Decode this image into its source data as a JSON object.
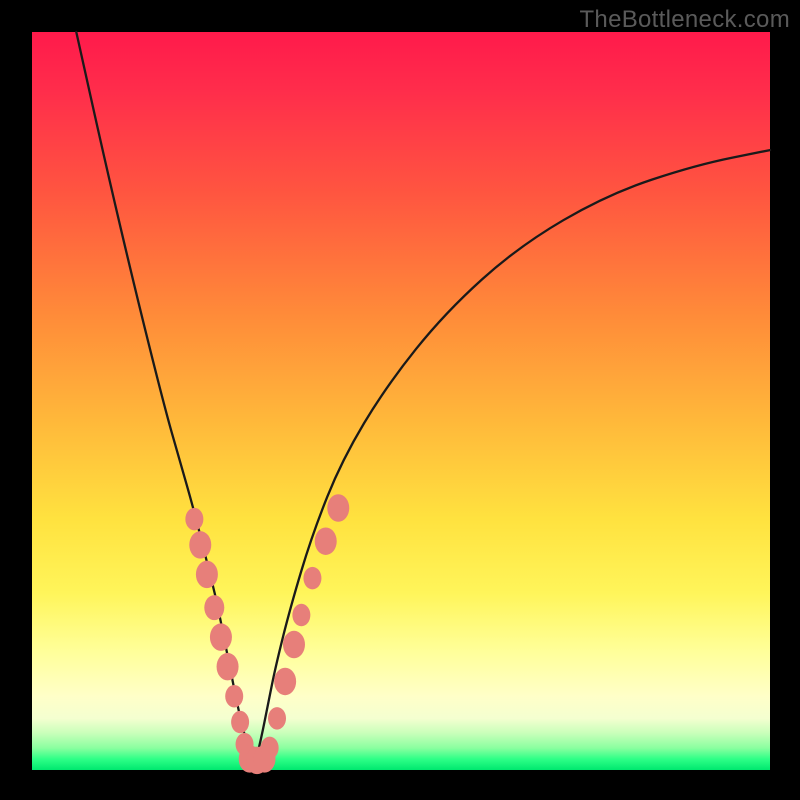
{
  "watermark": "TheBottleneck.com",
  "chart_data": {
    "type": "line",
    "title": "",
    "xlabel": "",
    "ylabel": "",
    "xlim": [
      0,
      100
    ],
    "ylim": [
      0,
      100
    ],
    "annotations": [],
    "description": "V-shaped bottleneck curve over a red-to-green vertical gradient background. No axis ticks or labels shown.",
    "series": [
      {
        "name": "left-branch",
        "x": [
          6,
          10,
          14,
          18,
          20,
          22,
          24,
          25,
          26,
          27,
          28,
          29,
          30
        ],
        "y": [
          100,
          82,
          65,
          49,
          42,
          35,
          27,
          23,
          18,
          13,
          8,
          4,
          0
        ]
      },
      {
        "name": "right-branch",
        "x": [
          30,
          31,
          32,
          33,
          35,
          38,
          42,
          48,
          56,
          66,
          78,
          90,
          100
        ],
        "y": [
          0,
          4,
          9,
          14,
          22,
          32,
          42,
          52,
          62,
          71,
          78,
          82,
          84
        ]
      }
    ],
    "markers": {
      "name": "beads",
      "color": "#e77f7a",
      "points": [
        {
          "x": 22.0,
          "y": 34.0,
          "r": 9
        },
        {
          "x": 22.8,
          "y": 30.5,
          "r": 11
        },
        {
          "x": 23.7,
          "y": 26.5,
          "r": 11
        },
        {
          "x": 24.7,
          "y": 22.0,
          "r": 10
        },
        {
          "x": 25.6,
          "y": 18.0,
          "r": 11
        },
        {
          "x": 26.5,
          "y": 14.0,
          "r": 11
        },
        {
          "x": 27.4,
          "y": 10.0,
          "r": 9
        },
        {
          "x": 28.2,
          "y": 6.5,
          "r": 9
        },
        {
          "x": 28.8,
          "y": 3.5,
          "r": 9
        },
        {
          "x": 29.5,
          "y": 1.5,
          "r": 11
        },
        {
          "x": 30.5,
          "y": 1.3,
          "r": 11
        },
        {
          "x": 31.5,
          "y": 1.5,
          "r": 11
        },
        {
          "x": 32.2,
          "y": 3.0,
          "r": 9
        },
        {
          "x": 33.2,
          "y": 7.0,
          "r": 9
        },
        {
          "x": 34.3,
          "y": 12.0,
          "r": 11
        },
        {
          "x": 35.5,
          "y": 17.0,
          "r": 11
        },
        {
          "x": 36.5,
          "y": 21.0,
          "r": 9
        },
        {
          "x": 38.0,
          "y": 26.0,
          "r": 9
        },
        {
          "x": 39.8,
          "y": 31.0,
          "r": 11
        },
        {
          "x": 41.5,
          "y": 35.5,
          "r": 11
        }
      ]
    }
  }
}
